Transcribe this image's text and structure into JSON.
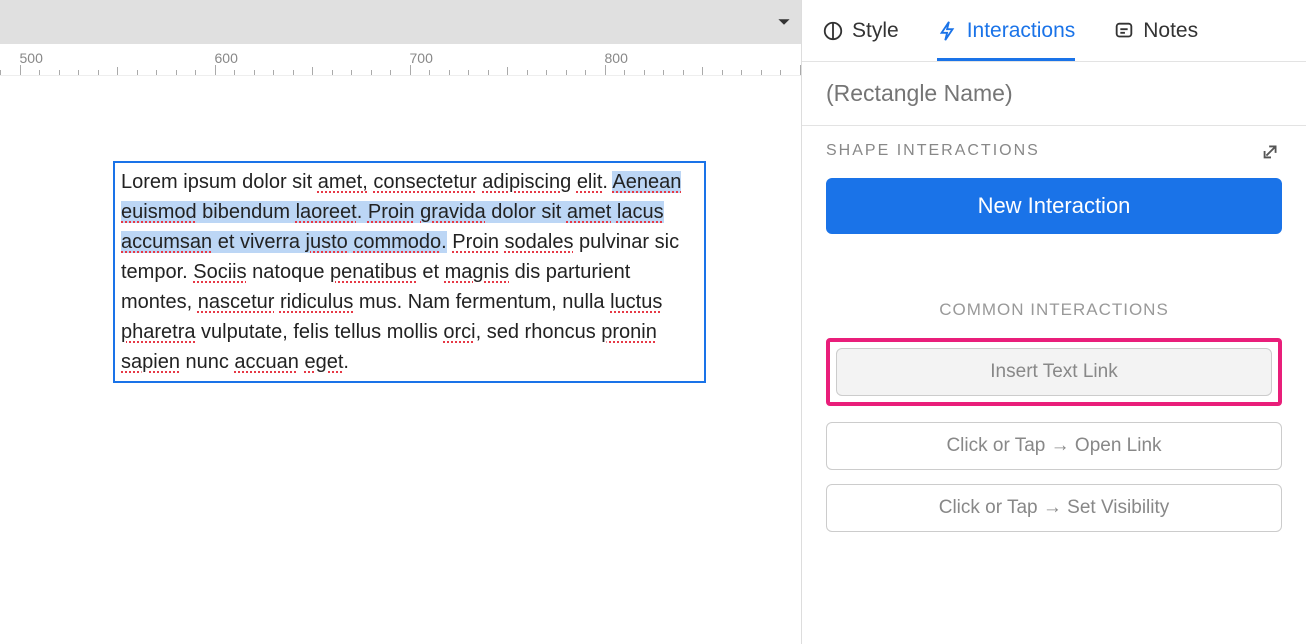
{
  "ruler": {
    "marks": [
      500,
      600,
      700,
      800
    ]
  },
  "textbox": {
    "pre_highlight": "Lorem ipsum dolor sit ",
    "pre_words": [
      {
        "t": "amet,",
        "err": true
      },
      {
        "t": " ",
        "err": false
      },
      {
        "t": "consectetur",
        "err": true
      },
      {
        "t": " ",
        "err": false
      },
      {
        "t": "adipiscing",
        "err": true
      },
      {
        "t": " ",
        "err": false
      },
      {
        "t": "elit",
        "err": true
      },
      {
        "t": ". ",
        "err": false
      }
    ],
    "highlight_words": [
      {
        "t": "Aenean",
        "err": true
      },
      {
        "t": " ",
        "err": false
      },
      {
        "t": "euismod",
        "err": true
      },
      {
        "t": " bibendum ",
        "err": false
      },
      {
        "t": "laoreet",
        "err": true
      },
      {
        "t": ". ",
        "err": false
      },
      {
        "t": "Proin",
        "err": true
      },
      {
        "t": " ",
        "err": false
      },
      {
        "t": "gravida",
        "err": true
      },
      {
        "t": " dolor sit ",
        "err": false
      },
      {
        "t": "amet",
        "err": true
      },
      {
        "t": " ",
        "err": false
      },
      {
        "t": "lacus",
        "err": true
      },
      {
        "t": " ",
        "err": false
      },
      {
        "t": "accumsan",
        "err": true
      },
      {
        "t": " et viverra ",
        "err": false
      },
      {
        "t": "justo",
        "err": true
      },
      {
        "t": " ",
        "err": false
      },
      {
        "t": "commodo",
        "err": true
      },
      {
        "t": ".",
        "err": false
      }
    ],
    "post_words": [
      {
        "t": " ",
        "err": false
      },
      {
        "t": "Proin",
        "err": true
      },
      {
        "t": " ",
        "err": false
      },
      {
        "t": "sodales",
        "err": true
      },
      {
        "t": " pulvinar sic tempor. ",
        "err": false
      },
      {
        "t": "Sociis",
        "err": true
      },
      {
        "t": " natoque ",
        "err": false
      },
      {
        "t": "penatibus",
        "err": true
      },
      {
        "t": " et ",
        "err": false
      },
      {
        "t": "magnis",
        "err": true
      },
      {
        "t": " dis parturient montes, ",
        "err": false
      },
      {
        "t": "nascetur",
        "err": true
      },
      {
        "t": " ",
        "err": false
      },
      {
        "t": "ridiculus",
        "err": true
      },
      {
        "t": " mus. Nam fermentum, nulla ",
        "err": false
      },
      {
        "t": "luctus",
        "err": true
      },
      {
        "t": " ",
        "err": false
      },
      {
        "t": "pharetra",
        "err": true
      },
      {
        "t": " vulputate, felis tellus mollis ",
        "err": false
      },
      {
        "t": "orci",
        "err": true
      },
      {
        "t": ", sed rhoncus ",
        "err": false
      },
      {
        "t": "pronin",
        "err": true
      },
      {
        "t": " ",
        "err": false
      },
      {
        "t": "sapien",
        "err": true
      },
      {
        "t": " nunc ",
        "err": false
      },
      {
        "t": "accuan",
        "err": true
      },
      {
        "t": " ",
        "err": false
      },
      {
        "t": "eget",
        "err": true
      },
      {
        "t": ".",
        "err": false
      }
    ]
  },
  "tabs": {
    "style": "Style",
    "interactions": "Interactions",
    "notes": "Notes"
  },
  "name_placeholder": "(Rectangle Name)",
  "section_title": "SHAPE INTERACTIONS",
  "new_interaction": "New Interaction",
  "common_title": "COMMON INTERACTIONS",
  "insert_text_link": "Insert Text Link",
  "open_link": "Click or Tap → Open Link",
  "set_visibility": "Click or Tap → Set Visibility"
}
